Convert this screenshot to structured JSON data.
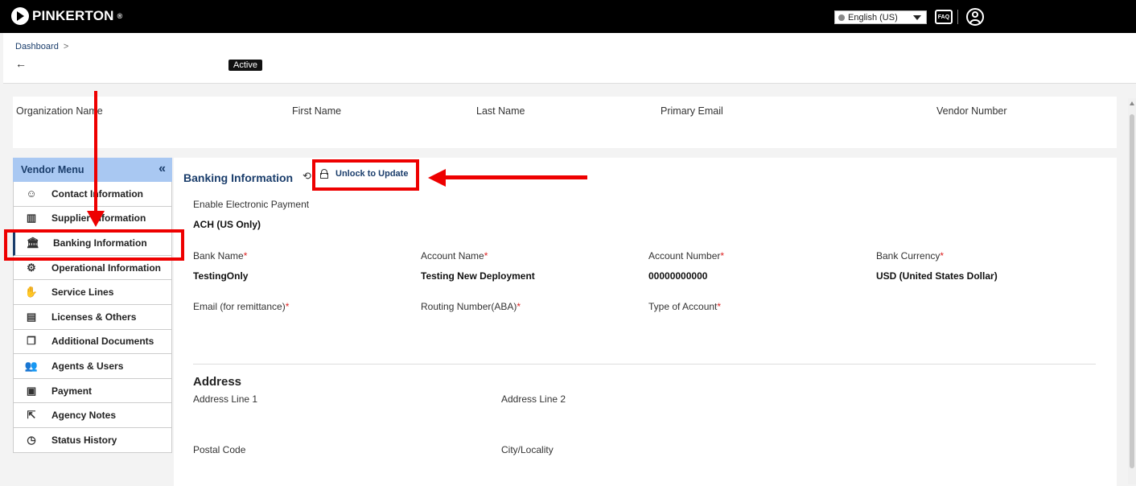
{
  "topbar": {
    "brand": "PINKERTON",
    "brand_mark": "®",
    "language": "English (US)",
    "faq_label": "FAQ"
  },
  "header": {
    "breadcrumb": "Dashboard",
    "back_arrow": "←",
    "status_badge": "Active"
  },
  "summary": {
    "columns": [
      "Organization Name",
      "First Name",
      "Last Name",
      "Primary Email",
      "Vendor Number"
    ]
  },
  "sidebar": {
    "title": "Vendor Menu",
    "collapse_glyph": "«",
    "items": [
      {
        "label": "Contact Information",
        "icon": "contact-icon"
      },
      {
        "label": "Supplier Information",
        "icon": "building-icon"
      },
      {
        "label": "Banking Information",
        "icon": "bank-icon",
        "selected": true
      },
      {
        "label": "Operational Information",
        "icon": "gears-icon"
      },
      {
        "label": "Service Lines",
        "icon": "hand-coin-icon"
      },
      {
        "label": "Licenses & Others",
        "icon": "id-card-icon"
      },
      {
        "label": "Additional Documents",
        "icon": "documents-icon"
      },
      {
        "label": "Agents & Users",
        "icon": "users-icon"
      },
      {
        "label": "Payment",
        "icon": "payment-icon"
      },
      {
        "label": "Agency Notes",
        "icon": "notes-icon"
      },
      {
        "label": "Status History",
        "icon": "status-history-icon"
      }
    ]
  },
  "banking": {
    "title": "Banking Information",
    "unlock_label": "Unlock to Update",
    "electronic_payment_label": "Enable Electronic Payment",
    "electronic_payment_value": "ACH (US Only)",
    "bank_name_label": "Bank Name",
    "bank_name_value": "TestingOnly",
    "account_name_label": "Account Name",
    "account_name_value": "Testing New Deployment",
    "account_number_label": "Account Number",
    "account_number_value": "00000000000",
    "bank_currency_label": "Bank Currency",
    "bank_currency_value": "USD (United States Dollar)",
    "email_label": "Email (for remittance)",
    "routing_label": "Routing Number(ABA)",
    "account_type_label": "Type of Account",
    "required_mark": "*"
  },
  "address": {
    "title": "Address",
    "line1_label": "Address Line 1",
    "line2_label": "Address Line 2",
    "postal_label": "Postal Code",
    "city_label": "City/Locality"
  },
  "colors": {
    "accent": "#1a3d6b",
    "menu_header": "#a9c8f2",
    "annotation": "#e00000"
  }
}
